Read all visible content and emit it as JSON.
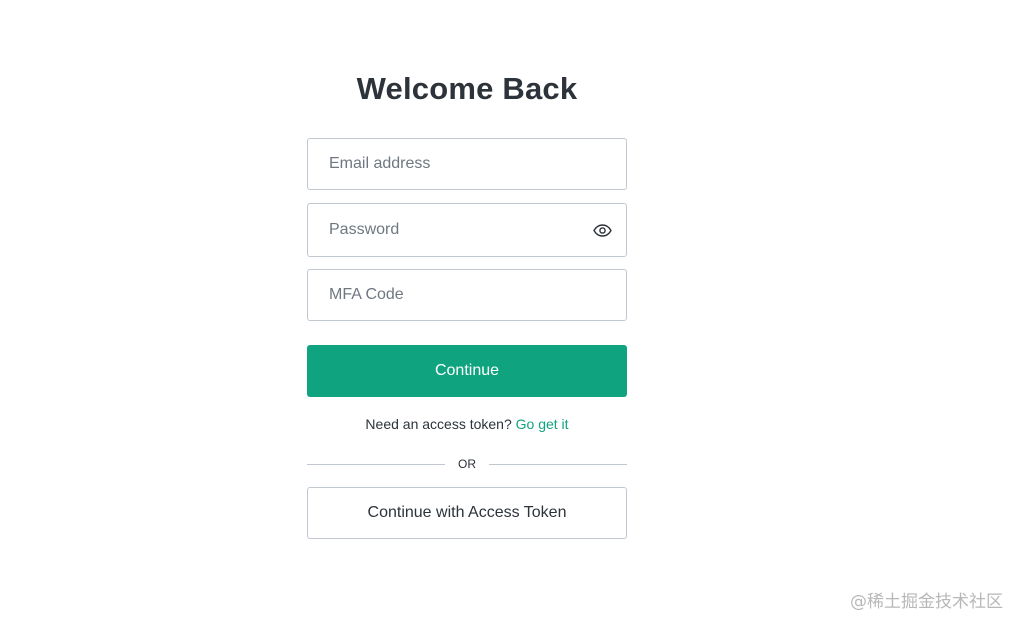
{
  "login": {
    "title": "Welcome Back",
    "email_placeholder": "Email address",
    "password_placeholder": "Password",
    "mfa_placeholder": "MFA Code",
    "continue_label": "Continue",
    "token_prompt": "Need an access token?",
    "token_link": "Go get it",
    "divider_text": "OR",
    "access_token_button": "Continue with Access Token"
  },
  "icons": {
    "password_toggle": "eye-icon"
  },
  "colors": {
    "accent": "#10a37f",
    "text": "#2d333a",
    "border": "#c2c8d0",
    "placeholder": "#6f7780"
  },
  "watermark": "@稀土掘金技术社区"
}
